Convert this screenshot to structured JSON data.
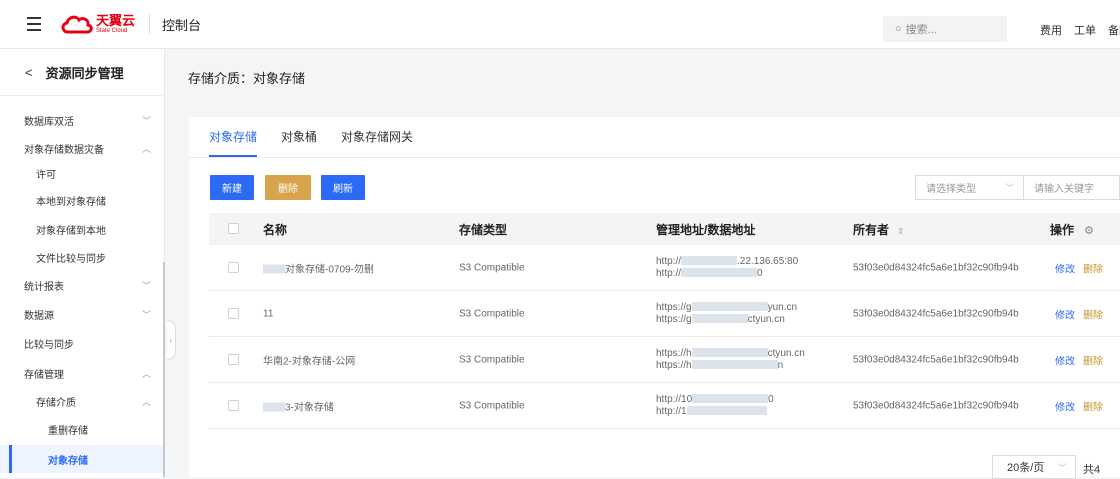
{
  "header": {
    "logo_cn": "天翼云",
    "logo_en": "State Cloud",
    "console_title": "控制台",
    "search_placeholder": "搜索...",
    "links": [
      "费用",
      "工单",
      "备案"
    ]
  },
  "sidebar": {
    "back": "<",
    "title": "资源同步管理",
    "items": [
      {
        "label": "数据库双活",
        "chevron": "﹀"
      },
      {
        "label": "对象存储数据灾备",
        "chevron": "︿"
      },
      {
        "label": "许可"
      },
      {
        "label": "本地到对象存储"
      },
      {
        "label": "对象存储到本地"
      },
      {
        "label": "文件比较与同步"
      },
      {
        "label": "统计报表",
        "chevron": "﹀"
      },
      {
        "label": "数据源",
        "chevron": "﹀"
      },
      {
        "label": "比较与同步"
      },
      {
        "label": "存储管理",
        "chevron": "︿"
      },
      {
        "label": "存储介质",
        "chevron": "︿"
      },
      {
        "label": "重删存储"
      },
      {
        "label": "对象存储"
      }
    ]
  },
  "page": {
    "title": "存储介质：对象存储"
  },
  "tabs": [
    "对象存储",
    "对象桶",
    "对象存储网关"
  ],
  "toolbar": {
    "new_label": "新建",
    "delete_label": "删除",
    "refresh_label": "刷新",
    "type_select_placeholder": "请选择类型",
    "keyword_placeholder": "请输入关键字"
  },
  "table": {
    "columns": [
      "名称",
      "存储类型",
      "管理地址/数据地址",
      "所有者",
      "操作"
    ],
    "rows": [
      {
        "name": "对象存储-0709-勿删",
        "type": "S3 Compatible",
        "addr1": "http://",
        "addr1_tail": ".22.136.65:80",
        "addr2": "http://",
        "addr2_tail": "0",
        "owner": "53f03e0d84324fc5a6e1bf32c90fb94b"
      },
      {
        "name": "11",
        "type": "S3 Compatible",
        "addr1": "https://g",
        "addr1_tail": "yun.cn",
        "addr2": "https://g",
        "addr2_tail": "ctyun.cn",
        "owner": "53f03e0d84324fc5a6e1bf32c90fb94b"
      },
      {
        "name": "华南2-对象存储-公网",
        "type": "S3 Compatible",
        "addr1": "https://h",
        "addr1_tail": "ctyun.cn",
        "addr2": "https://h",
        "addr2_tail": "n",
        "owner": "53f03e0d84324fc5a6e1bf32c90fb94b"
      },
      {
        "name": "3-对象存储",
        "type": "S3 Compatible",
        "addr1": "http://10",
        "addr1_tail": "0",
        "addr2": "http://1",
        "addr2_tail": "",
        "owner": "53f03e0d84324fc5a6e1bf32c90fb94b"
      }
    ],
    "edit_label": "修改",
    "delete_label": "删除"
  },
  "pagination": {
    "page_size": "20条/页",
    "total": "共4"
  },
  "colors": {
    "primary": "#2c6af5",
    "warning": "#d7a44c",
    "brand": "#e60012"
  }
}
